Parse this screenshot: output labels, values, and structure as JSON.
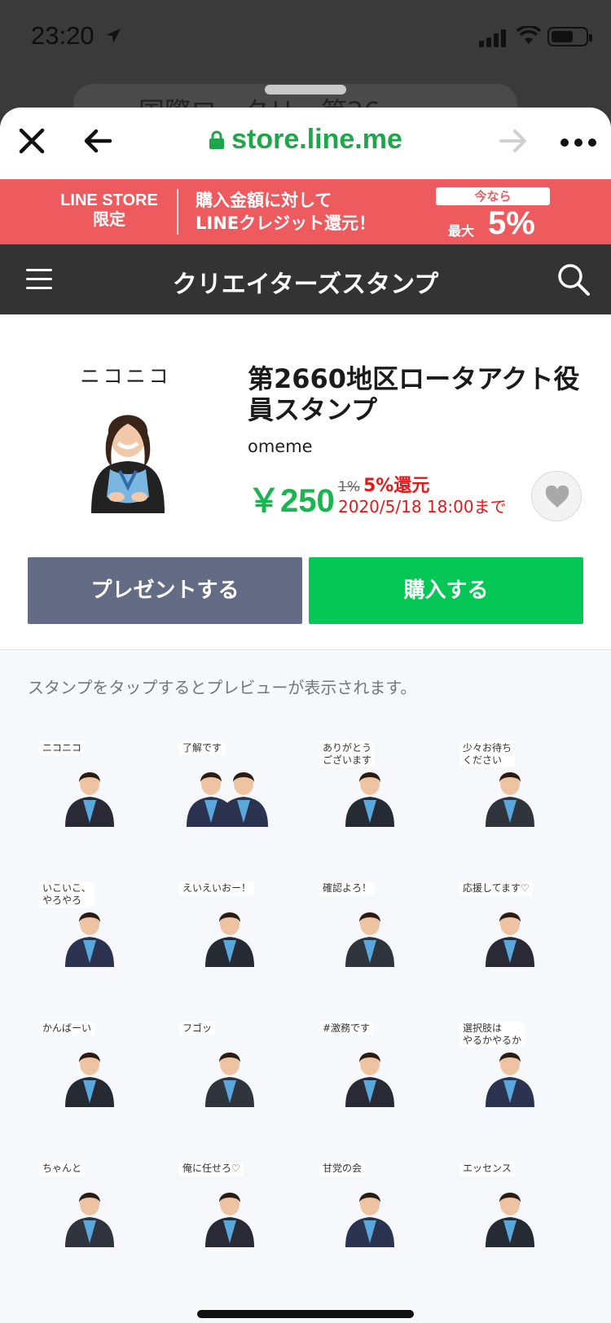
{
  "status_bar": {
    "time": "23:20"
  },
  "background_page": {
    "search_text": "国際ロータリー第26"
  },
  "nav": {
    "url": "store.line.me"
  },
  "promo": {
    "store_line1": "LINE STORE",
    "store_line2": "限定",
    "msg_line1": "購入金額に対して",
    "msg_line2": "LINEクレジット還元！",
    "now": "今なら",
    "max": "最大",
    "percent": "5%"
  },
  "category": {
    "title": "クリエイターズスタンプ"
  },
  "product": {
    "thumb_label": "ニコニコ",
    "title": "第2660地区ロータアクト役員スタンプ",
    "author": "omeme",
    "price": "￥250",
    "old_rebate": "1%",
    "new_rebate": "5%還元",
    "deadline": "2020/5/18 18:00まで",
    "gift_label": "プレゼントする",
    "buy_label": "購入する"
  },
  "stickers": {
    "hint": "スタンプをタップするとプレビューが表示されます。",
    "items": [
      {
        "caption": "ニコニコ"
      },
      {
        "caption": "了解です"
      },
      {
        "caption": "ありがとう\nございます"
      },
      {
        "caption": "少々お待ち\nください"
      },
      {
        "caption": "いこいこ、\nやろやろ"
      },
      {
        "caption": "えいえいおー！"
      },
      {
        "caption": "確認よろ！"
      },
      {
        "caption": "応援してます♡"
      },
      {
        "caption": "かんばーい"
      },
      {
        "caption": "フゴッ"
      },
      {
        "caption": "#激務です"
      },
      {
        "caption": "選択肢は\nやるかやるか"
      },
      {
        "caption": "ちゃんと"
      },
      {
        "caption": "俺に任せろ♡"
      },
      {
        "caption": "甘党の会"
      },
      {
        "caption": "エッセンス"
      }
    ]
  },
  "colors": {
    "line_green": "#05c755",
    "price_green": "#18b64e",
    "promo_red": "#ee5b5e",
    "gift_button": "#646b85",
    "header_dark": "#333333"
  }
}
